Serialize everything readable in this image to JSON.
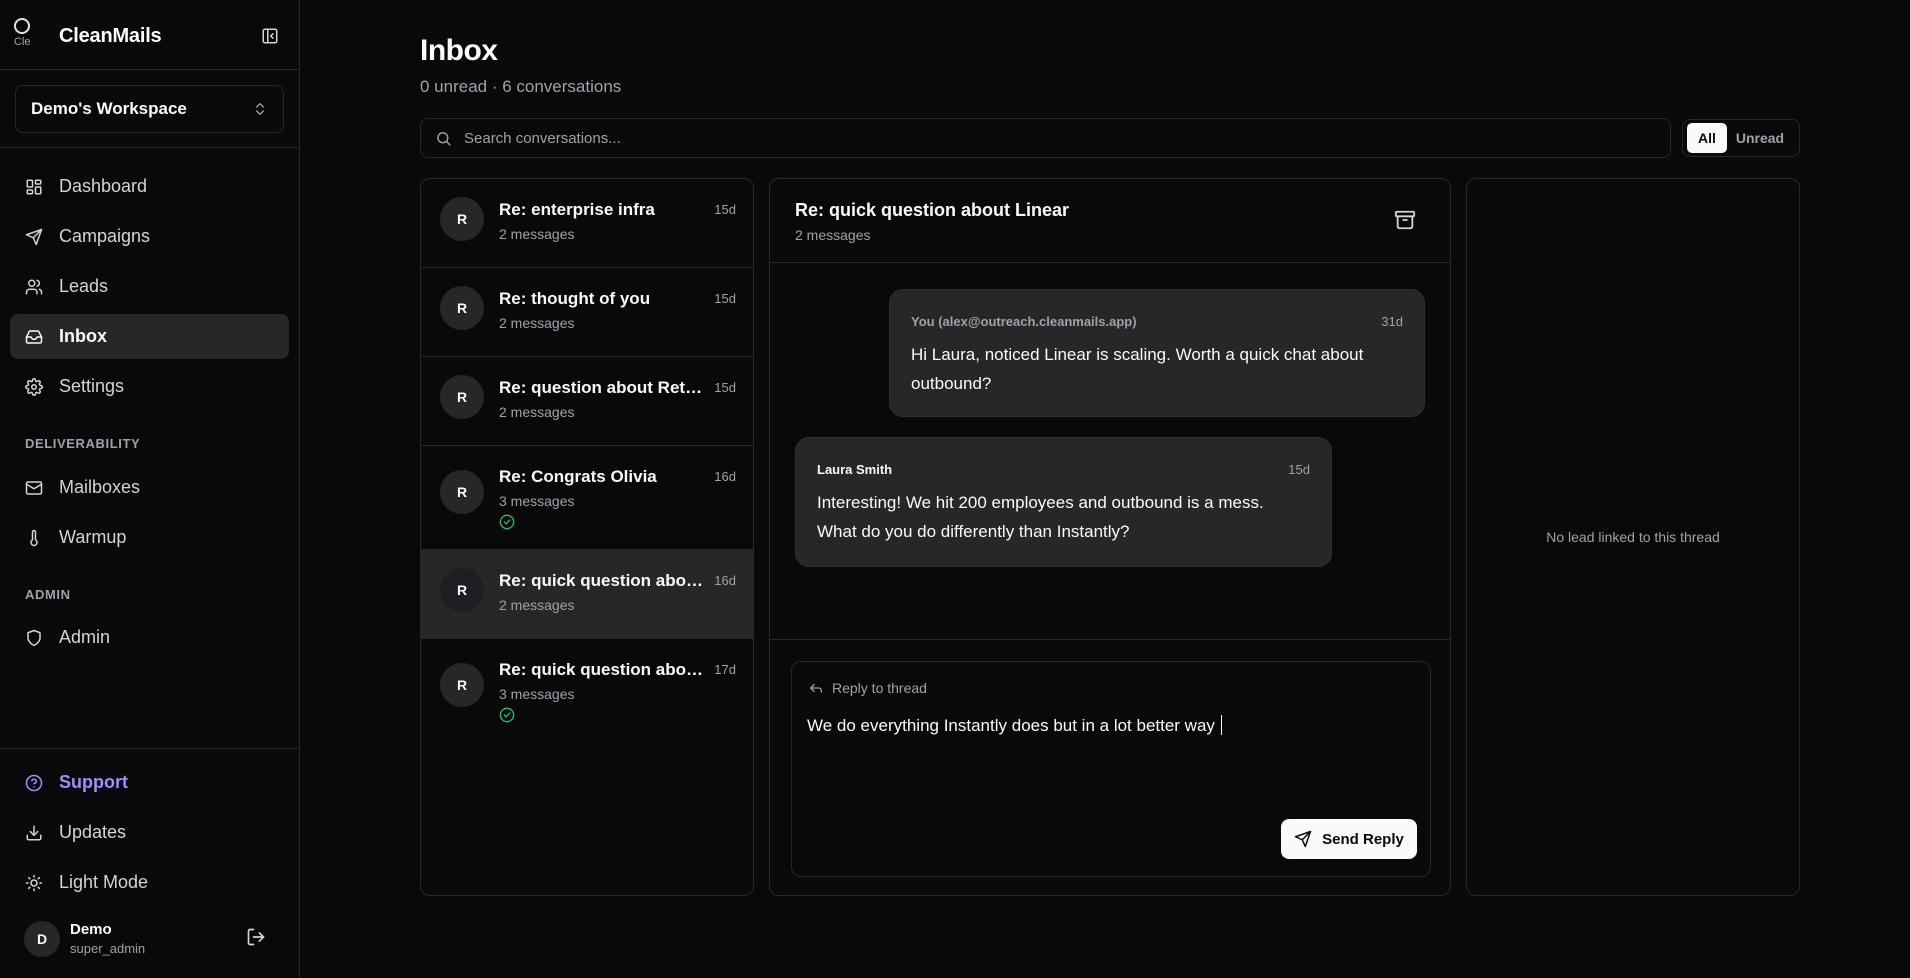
{
  "app": {
    "name": "CleanMails",
    "logo_alt": "Cle"
  },
  "workspace": {
    "name": "Demo's Workspace"
  },
  "nav": {
    "main": [
      {
        "label": "Dashboard",
        "icon": "dashboard-icon"
      },
      {
        "label": "Campaigns",
        "icon": "send-icon"
      },
      {
        "label": "Leads",
        "icon": "users-icon"
      },
      {
        "label": "Inbox",
        "icon": "inbox-icon",
        "active": true
      },
      {
        "label": "Settings",
        "icon": "gear-icon"
      }
    ],
    "deliverability_heading": "DELIVERABILITY",
    "deliverability": [
      {
        "label": "Mailboxes",
        "icon": "mail-icon"
      },
      {
        "label": "Warmup",
        "icon": "thermometer-icon"
      }
    ],
    "admin_heading": "ADMIN",
    "admin": [
      {
        "label": "Admin",
        "icon": "shield-icon"
      }
    ],
    "footer": [
      {
        "label": "Support",
        "icon": "help-circle-icon"
      },
      {
        "label": "Updates",
        "icon": "download-icon"
      },
      {
        "label": "Light Mode",
        "icon": "sun-icon"
      }
    ]
  },
  "user": {
    "initial": "D",
    "name": "Demo",
    "role": "super_admin"
  },
  "page": {
    "title": "Inbox",
    "subtitle": "0 unread · 6 conversations"
  },
  "search": {
    "placeholder": "Search conversations..."
  },
  "filters": {
    "all": "All",
    "unread": "Unread",
    "selected": "All"
  },
  "conversations": [
    {
      "initial": "R",
      "subject": "Re: enterprise infra",
      "count": "2 messages",
      "time": "15d",
      "replied": false,
      "selected": false
    },
    {
      "initial": "R",
      "subject": "Re: thought of you",
      "count": "2 messages",
      "time": "15d",
      "replied": false,
      "selected": false
    },
    {
      "initial": "R",
      "subject": "Re: question about Retool",
      "count": "2 messages",
      "time": "15d",
      "replied": false,
      "selected": false
    },
    {
      "initial": "R",
      "subject": "Re: Congrats Olivia",
      "count": "3 messages",
      "time": "16d",
      "replied": true,
      "selected": false
    },
    {
      "initial": "R",
      "subject": "Re: quick question about Linear",
      "count": "2 messages",
      "time": "16d",
      "replied": false,
      "selected": true
    },
    {
      "initial": "R",
      "subject": "Re: quick question about Linear",
      "count": "3 messages",
      "time": "17d",
      "replied": true,
      "selected": false
    }
  ],
  "thread": {
    "title": "Re: quick question about Linear",
    "count": "2 messages",
    "messages": [
      {
        "from": "You (alex@outreach.cleanmails.app)",
        "time": "31d",
        "body": "Hi Laura, noticed Linear is scaling. Worth a quick chat about outbound?",
        "outgoing": true
      },
      {
        "from": "Laura Smith",
        "time": "15d",
        "body": "Interesting! We hit 200 employees and outbound is a mess. What do you do differently than Instantly?",
        "outgoing": false
      }
    ],
    "reply": {
      "label": "Reply to thread",
      "draft": "We do everything Instantly does but in a lot better way",
      "send_label": "Send Reply"
    }
  },
  "lead_panel": {
    "empty_text": "No lead linked to this thread"
  },
  "colors": {
    "background": "#09090b",
    "border": "#27272a",
    "accent": "#a78bfa",
    "success": "#22c55e"
  }
}
